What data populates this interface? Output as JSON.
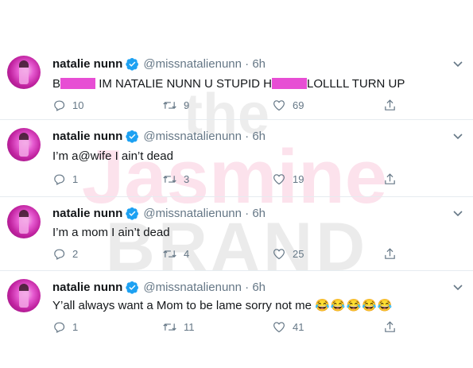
{
  "watermark": {
    "line1": "the",
    "line2": "Jasmine",
    "line3": "BRAND"
  },
  "tweets": [
    {
      "name": "natalie nunn",
      "handle": "@missnatalienunn",
      "time": "6h",
      "text_part1": "B",
      "text_part2": "IM NATALIE NUNN U STUPID H",
      "text_part3": "LOLLLL TURN UP",
      "replies": "10",
      "retweets": "9",
      "likes": "69"
    },
    {
      "name": "natalie nunn",
      "handle": "@missnatalienunn",
      "time": "6h",
      "text": "I’m a@wife I ain’t dead",
      "replies": "1",
      "retweets": "3",
      "likes": "19"
    },
    {
      "name": "natalie nunn",
      "handle": "@missnatalienunn",
      "time": "6h",
      "text": "I’m a mom I ain’t dead",
      "replies": "2",
      "retweets": "4",
      "likes": "25"
    },
    {
      "name": "natalie nunn",
      "handle": "@missnatalienunn",
      "time": "6h",
      "text": "Y’all always want a Mom to be lame sorry not me",
      "emoji": "😂😂😂😂😂",
      "replies": "1",
      "retweets": "11",
      "likes": "41"
    }
  ],
  "colors": {
    "verified": "#1da1f2",
    "icon": "#657786",
    "divider": "#e6ecf0",
    "censor": "#e74ed4"
  },
  "icons": [
    "verified-badge-icon",
    "chevron-down-icon",
    "reply-icon",
    "retweet-icon",
    "like-icon",
    "share-icon"
  ]
}
